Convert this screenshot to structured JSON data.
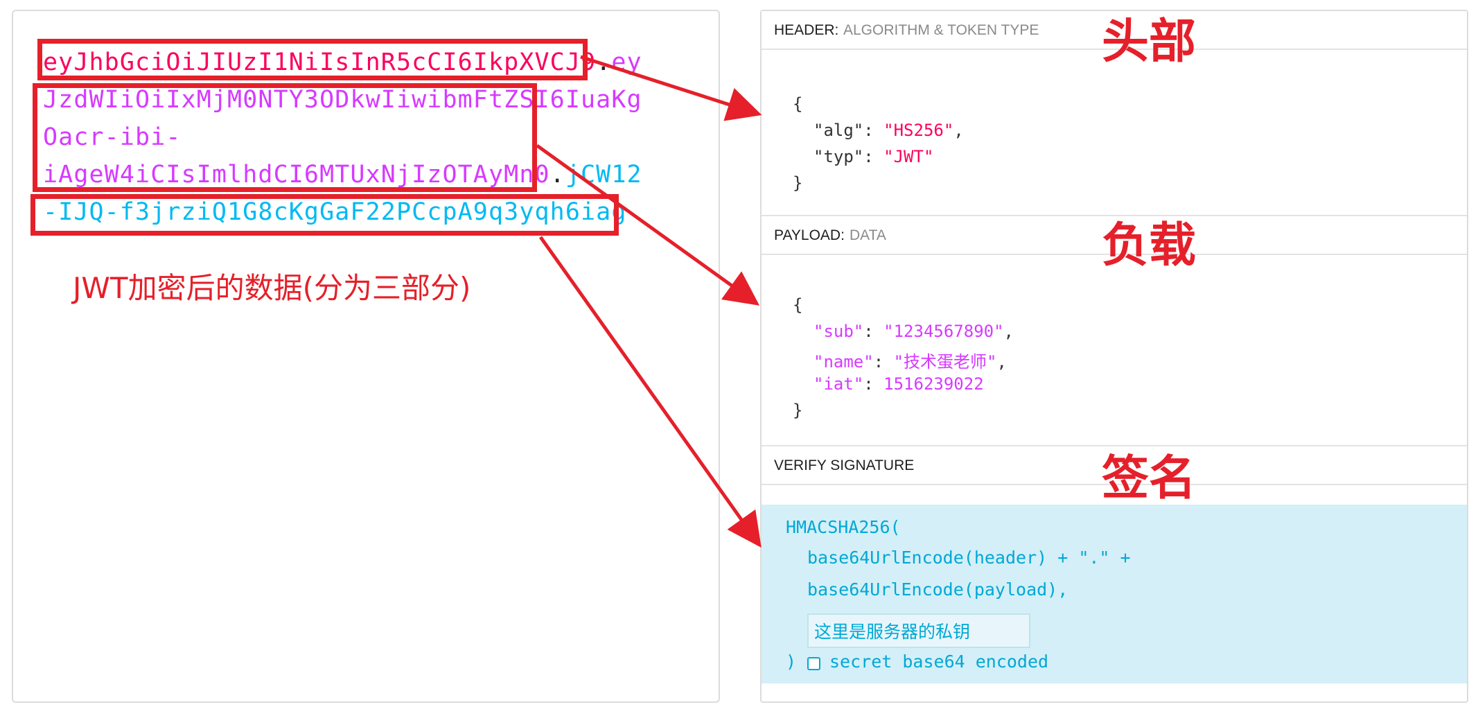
{
  "encoded": {
    "lines": [
      {
        "header": "eyJhbGciOiJIUzI1NiIsInR5cCI6IkpXVCJ9",
        "dot": ".",
        "payload": "ey"
      },
      {
        "payload": "JzdWIiOiIxMjM0NTY3ODkwIiwibmFtZSI6IuaKg"
      },
      {
        "payload": "Oacr-ibi-"
      },
      {
        "payload": "iAgeW4iCIsImlhdCI6MTUxNjIzOTAyMn0",
        "dot": ".",
        "signature": "jCW12"
      },
      {
        "signature": "-IJQ-f3jrziQ1G8cKgGaF22PCcpA9q3yqh6iag"
      }
    ],
    "caption": "JWT加密后的数据(分为三部分)"
  },
  "decoded": {
    "header_section": {
      "title": "HEADER:",
      "subtitle": "ALGORITHM & TOKEN TYPE"
    },
    "header_json": {
      "open": "{",
      "alg_key": "\"alg\"",
      "alg_value": "\"HS256\"",
      "typ_key": "\"typ\"",
      "typ_value": "\"JWT\"",
      "close": "}"
    },
    "payload_section": {
      "title": "PAYLOAD:",
      "subtitle": "DATA"
    },
    "payload_json": {
      "open": "{",
      "sub_key": "\"sub\"",
      "sub_value": "\"1234567890\"",
      "name_key": "\"name\"",
      "name_value": "\"技术蛋老师\"",
      "iat_key": "\"iat\"",
      "iat_value": "1516239022",
      "close": "}"
    },
    "signature_section": {
      "title": "VERIFY SIGNATURE"
    },
    "signature": {
      "line1": "HMACSHA256(",
      "line2": "base64UrlEncode(header) + \".\" +",
      "line3": "base64UrlEncode(payload),",
      "secret_value": "这里是服务器的私钥",
      "close": ")",
      "checkbox_label": "secret base64 encoded",
      "checkbox_checked": false
    }
  },
  "annotations": {
    "header_label": "头部",
    "payload_label": "负载",
    "signature_label": "签名",
    "color": "#e5202a"
  },
  "colors": {
    "header": "#fb015b",
    "payload": "#d63aff",
    "signature": "#00b9f1"
  }
}
